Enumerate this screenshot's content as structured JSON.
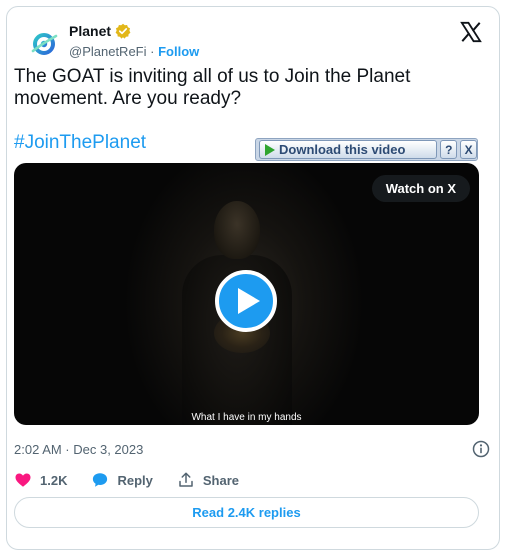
{
  "author": {
    "name": "Planet",
    "handle": "@PlanetReFi",
    "separator": "·",
    "follow_label": "Follow"
  },
  "icons": {
    "avatar": "planet-logo-icon",
    "verified": "verified-gold-badge-icon",
    "platform": "x-logo-icon",
    "info": "info-icon",
    "like": "heart-icon",
    "reply": "speech-bubble-icon",
    "share": "share-arrow-icon",
    "play": "play-icon"
  },
  "tweet": {
    "text": "The GOAT is inviting all of us to Join the Planet movement. Are you ready?",
    "hashtag": "#JoinThePlanet"
  },
  "download_bar": {
    "label": "Download this video",
    "help": "?",
    "close": "X"
  },
  "video": {
    "watch_label": "Watch on X",
    "caption": "What I have in my hands"
  },
  "meta": {
    "timestamp": "2:02 AM · Dec 3, 2023"
  },
  "actions": {
    "like_count": "1.2K",
    "reply_label": "Reply",
    "share_label": "Share"
  },
  "footer": {
    "read_replies": "Read 2.4K replies"
  },
  "colors": {
    "accent": "#1d9bf0",
    "like": "#f91880",
    "text": "#0f1419",
    "muted": "#536471",
    "border": "#cfd9de"
  }
}
